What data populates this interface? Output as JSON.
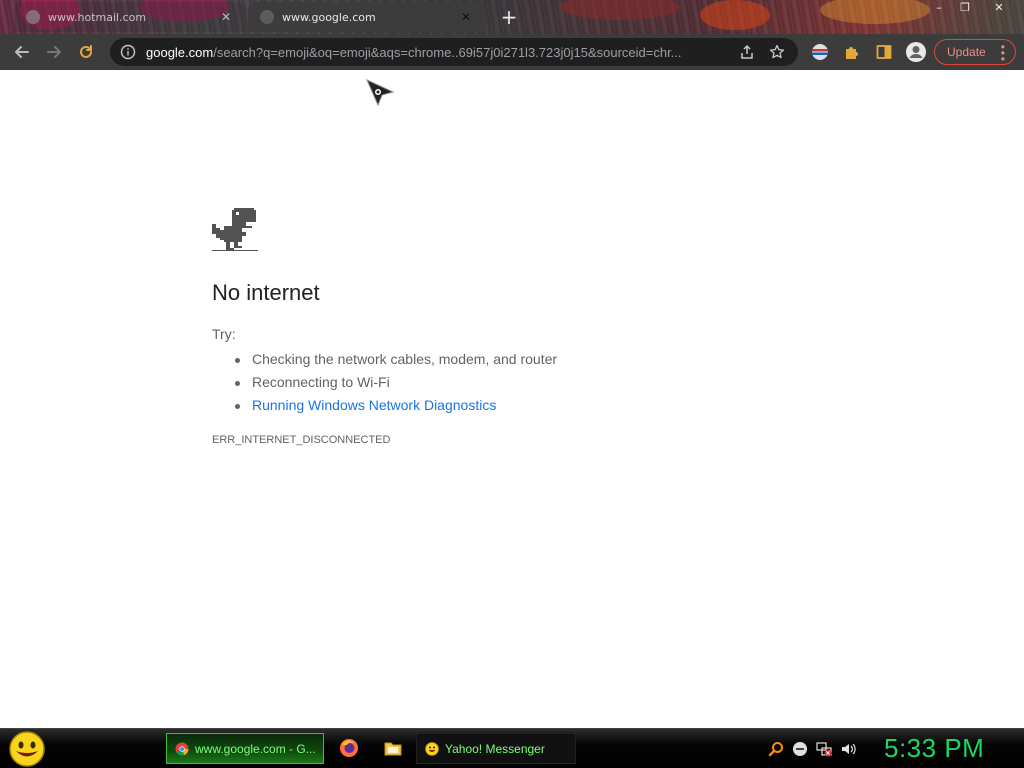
{
  "browser": {
    "tabs": [
      {
        "title": "www.hotmail.com",
        "active": false
      },
      {
        "title": "www.google.com",
        "active": true
      }
    ],
    "new_tab_symbol": "+",
    "window_controls": {
      "minimize": "–",
      "restore": "❐",
      "close": "✕"
    },
    "address_bar": {
      "host": "google.com",
      "path": "/search?q=emoji&oq=emoji&aqs=chrome..69i57j0i271l3.723j0j15&sourceid=chr..."
    },
    "update_label": "Update",
    "accent_color": "#e0473a"
  },
  "error_page": {
    "headline": "No internet",
    "try_label": "Try:",
    "suggestions": [
      "Checking the network cables, modem, and router",
      "Reconnecting to Wi-Fi",
      "Running Windows Network Diagnostics"
    ],
    "error_code": "ERR_INTERNET_DISCONNECTED"
  },
  "taskbar": {
    "items": [
      {
        "label": "www.google.com - G...",
        "icon": "chrome-icon",
        "active": true
      },
      {
        "label": "Yahoo! Messenger",
        "icon": "yahoo-messenger-icon",
        "active": false
      }
    ],
    "quick_launch": [
      "firefox-icon",
      "folder-icon"
    ],
    "tray": [
      "search-icon",
      "minus-circle-icon",
      "network-disconnected-icon",
      "volume-icon"
    ],
    "clock": "5:33 PM",
    "clock_color": "#1ed760"
  }
}
